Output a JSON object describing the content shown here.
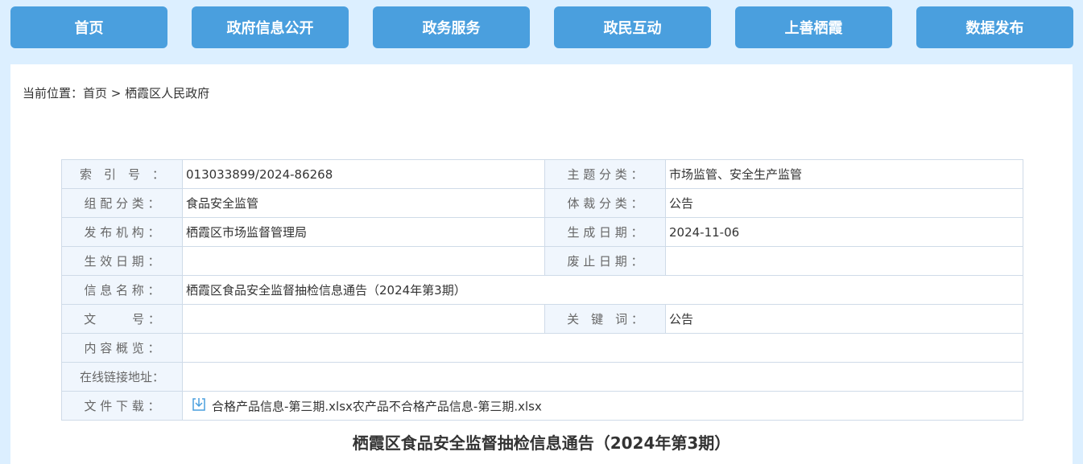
{
  "nav": {
    "items": [
      {
        "label": "首页"
      },
      {
        "label": "政府信息公开"
      },
      {
        "label": "政务服务"
      },
      {
        "label": "政民互动"
      },
      {
        "label": "上善栖霞"
      },
      {
        "label": "数据发布"
      }
    ]
  },
  "breadcrumb": {
    "prefix": "当前位置：",
    "home": "首页",
    "separator": " > ",
    "current": "栖霞区人民政府"
  },
  "meta": {
    "index_label": "索　引　号　：",
    "index_value": "013033899/2024-86268",
    "topic_label": "主 题 分 类 ：",
    "topic_value": "市场监管、安全生产监管",
    "group_label": "组 配 分 类 ：",
    "group_value": "食品安全监管",
    "genre_label": "体 裁 分 类 ：",
    "genre_value": "公告",
    "publisher_label": "发 布 机 构 ：",
    "publisher_value": "栖霞区市场监督管理局",
    "created_label": "生 成 日 期 ：",
    "created_value": "2024-11-06",
    "effective_label": "生 效 日 期 ：",
    "effective_value": "",
    "repeal_label": "废 止 日 期 ：",
    "repeal_value": "",
    "name_label": "信 息 名 称 ：",
    "name_value": "栖霞区食品安全监督抽检信息通告（2024年第3期）",
    "docno_label": "文　　　号 ：",
    "docno_value": "",
    "keyword_label": "关　键　词 ：",
    "keyword_value": "公告",
    "summary_label": "内 容 概 览 ：",
    "summary_value": "",
    "link_label": "在线链接地址：",
    "link_value": "",
    "download_label": "文 件 下 载 ：",
    "download_files": "合格产品信息-第三期.xlsx农产品不合格产品信息-第三期.xlsx"
  },
  "article": {
    "title": "栖霞区食品安全监督抽检信息通告（2024年第3期）"
  },
  "colors": {
    "nav_button": "#4a9fde",
    "page_bg": "#dcefff",
    "label_cell_bg": "#f0f6fd",
    "border": "#cfdbe8"
  },
  "icons": {
    "download": "download-icon"
  }
}
